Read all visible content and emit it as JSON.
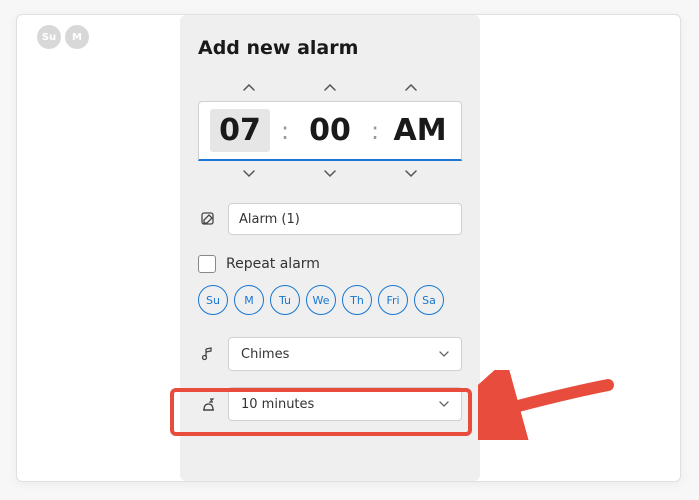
{
  "bg_days": [
    "Su",
    "M"
  ],
  "panel": {
    "title": "Add new alarm",
    "time": {
      "hour": "07",
      "minute": "00",
      "ampm": "AM"
    },
    "alarm_name": "Alarm (1)",
    "repeat_label": "Repeat alarm",
    "days": [
      "Su",
      "M",
      "Tu",
      "We",
      "Th",
      "Fri",
      "Sa"
    ],
    "sound": "Chimes",
    "snooze": "10 minutes"
  }
}
